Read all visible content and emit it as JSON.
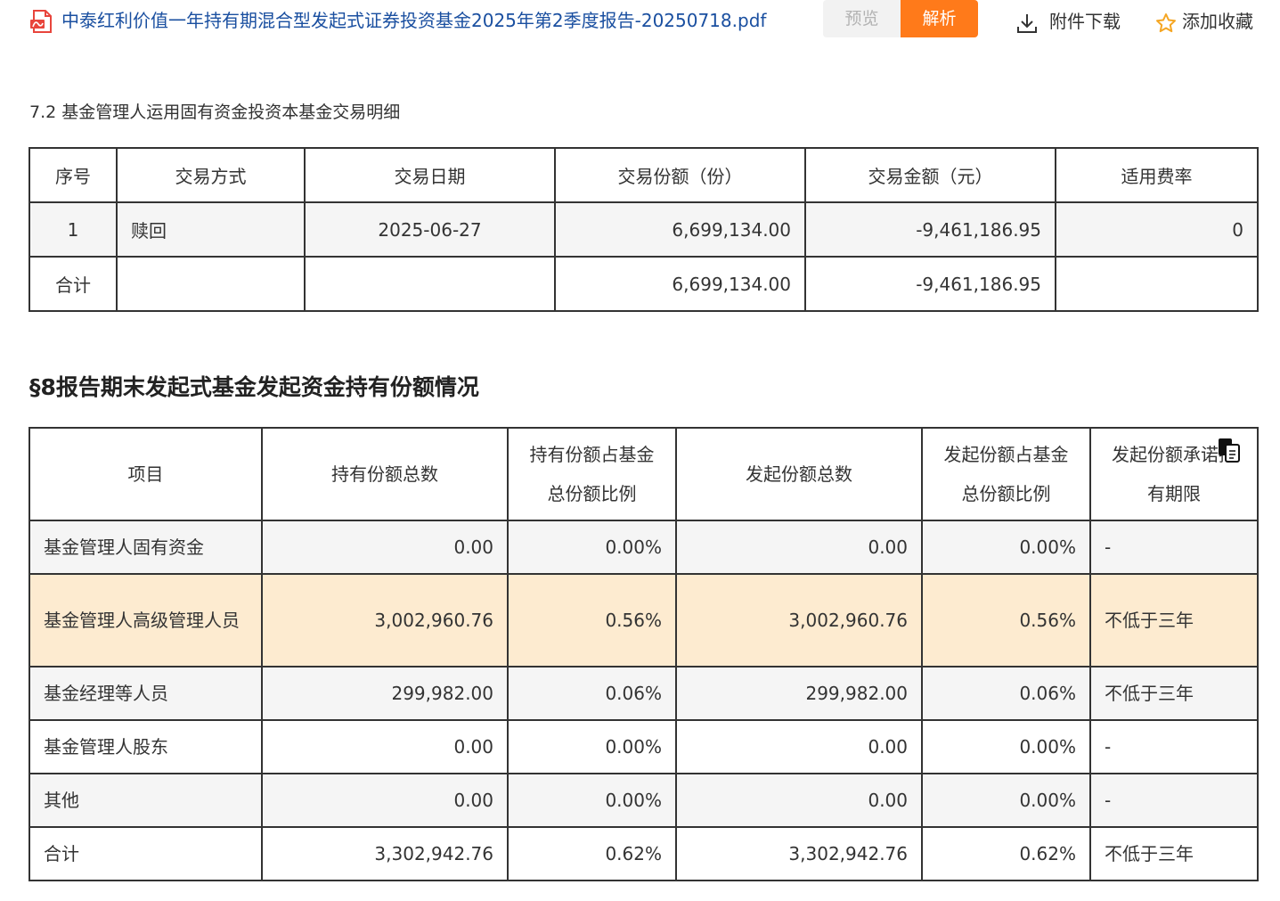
{
  "header": {
    "file_title": "中泰红利价值一年持有期混合型发起式证券投资基金2025年第2季度报告-20250718.pdf",
    "preview_label": "预览",
    "parse_label": "解析",
    "download_label": "附件下载",
    "favorite_label": "添加收藏"
  },
  "section72": {
    "title": "7.2 基金管理人运用固有资金投资本基金交易明细",
    "columns": [
      "序号",
      "交易方式",
      "交易日期",
      "交易份额（份）",
      "交易金额（元）",
      "适用费率"
    ],
    "rows": [
      [
        "1",
        "赎回",
        "2025-06-27",
        "6,699,134.00",
        "-9,461,186.95",
        "0"
      ],
      [
        "合计",
        "",
        "",
        "6,699,134.00",
        "-9,461,186.95",
        ""
      ]
    ]
  },
  "section8": {
    "title": "§8报告期末发起式基金发起资金持有份额情况",
    "columns": [
      "项目",
      "持有份额总数",
      "持有份额占基金总份额比例",
      "发起份额总数",
      "发起份额占基金总份额比例",
      "发起份额承诺持有期限"
    ],
    "rows": [
      [
        "基金管理人固有资金",
        "0.00",
        "0.00%",
        "0.00",
        "0.00%",
        "-"
      ],
      [
        "基金管理人高级管理人员",
        "3,002,960.76",
        "0.56%",
        "3,002,960.76",
        "0.56%",
        "不低于三年"
      ],
      [
        "基金经理等人员",
        "299,982.00",
        "0.06%",
        "299,982.00",
        "0.06%",
        "不低于三年"
      ],
      [
        "基金管理人股东",
        "0.00",
        "0.00%",
        "0.00",
        "0.00%",
        "-"
      ],
      [
        "其他",
        "0.00",
        "0.00%",
        "0.00",
        "0.00%",
        "-"
      ],
      [
        "合计",
        "3,302,942.76",
        "0.62%",
        "3,302,942.76",
        "0.62%",
        "不低于三年"
      ]
    ]
  },
  "colors": {
    "title_link": "#1a4fa0",
    "accent": "#ff7a1a",
    "highlight_row": "#fdebd0",
    "star": "#f5a623",
    "pdf_icon": "#e8453c"
  },
  "icons": [
    "pdf-file-icon",
    "download-icon",
    "star-icon",
    "copy-icon"
  ]
}
